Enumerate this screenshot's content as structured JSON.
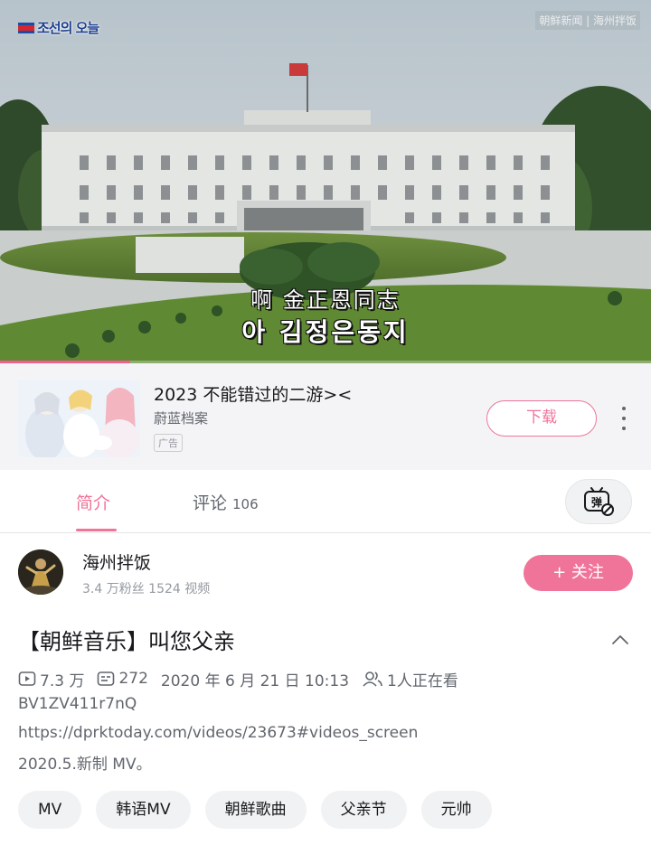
{
  "video": {
    "channel_logo_text": "조선의 오늘",
    "watermark": "朝鲜新闻 | 海州拌饭",
    "subtitle_cn": "啊 金正恩同志",
    "subtitle_kr": "아 김정은동지",
    "progress_fraction": 0.2
  },
  "ad": {
    "title": "2023 不能错过的二游><",
    "publisher": "蔚蓝档案",
    "badge": "广告",
    "download_label": "下载",
    "more_icon": "more-vertical-icon"
  },
  "tabs": {
    "intro_label": "简介",
    "comments_label": "评论",
    "comments_count": "106",
    "danmaku_icon": "danmaku-off-icon",
    "danmaku_glyph": "弹"
  },
  "uploader": {
    "name": "海州拌饭",
    "stats": "3.4 万粉丝  1524 视频",
    "follow_label": "+ 关注"
  },
  "video_info": {
    "title": "【朝鲜音乐】叫您父亲",
    "views": "7.3 万",
    "danmaku_count": "272",
    "publish_time": "2020 年 6 月 21 日  10:13",
    "watching": "1人正在看",
    "bvid": "BV1ZV411r7nQ",
    "source_url": "https://dprktoday.com/videos/23673#videos_screen",
    "description": "2020.5.新制 MV。"
  },
  "tags": [
    "MV",
    "韩语MV",
    "朝鲜歌曲",
    "父亲节",
    "元帅"
  ],
  "colors": {
    "accent_pink": "#f07499",
    "text_primary": "#18191c",
    "text_secondary": "#61666d"
  }
}
